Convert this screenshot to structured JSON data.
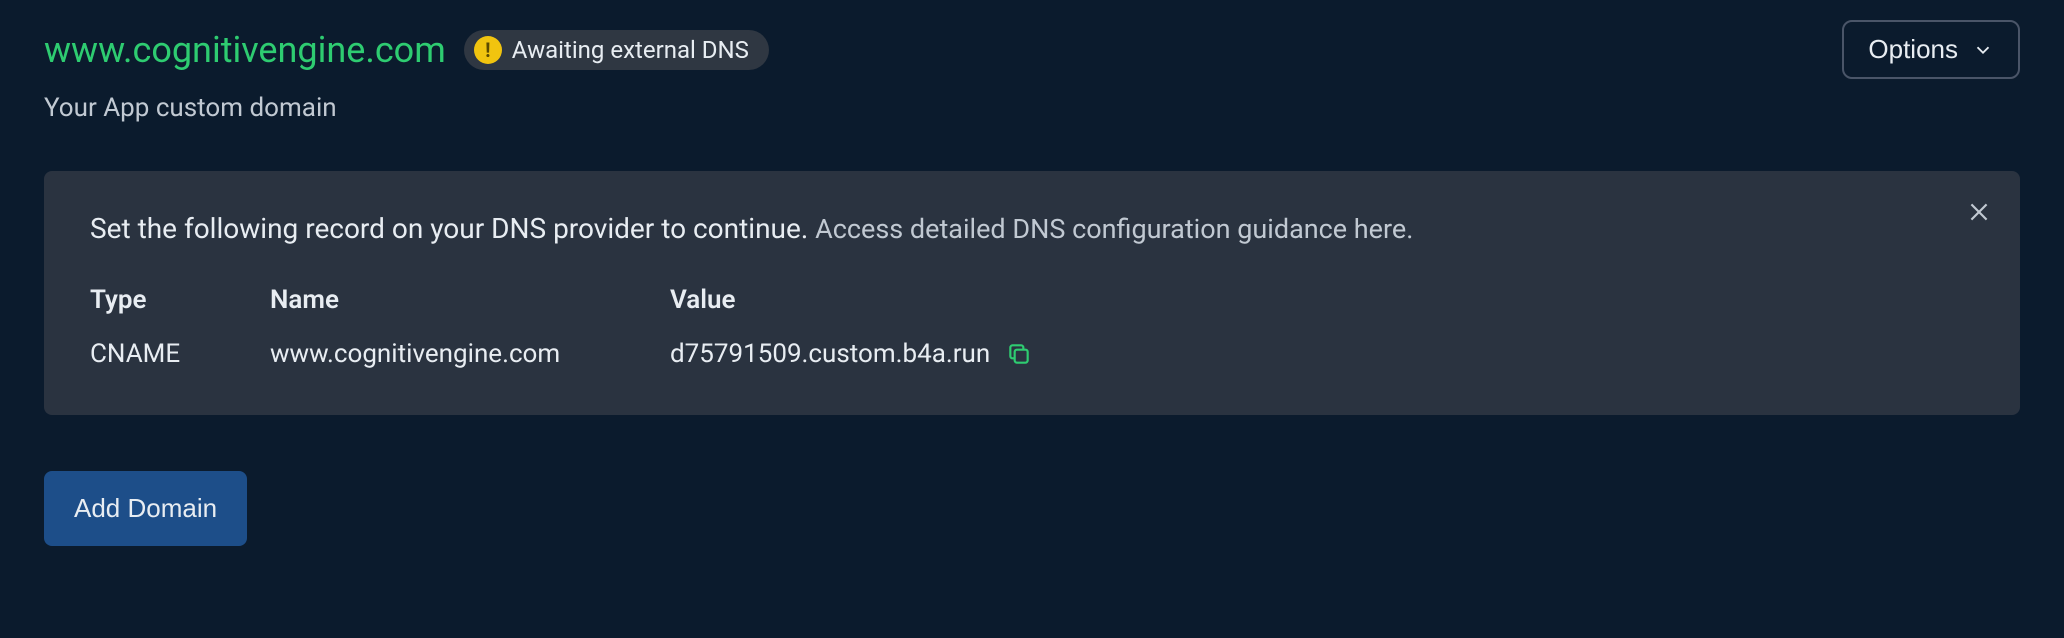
{
  "header": {
    "domain": "www.cognitivengine.com",
    "status": "Awaiting external DNS",
    "options_label": "Options"
  },
  "subtitle": "Your App custom domain",
  "panel": {
    "instruction": "Set the following record on your DNS provider to continue.",
    "link": "Access detailed DNS configuration guidance here.",
    "columns": {
      "type": "Type",
      "name": "Name",
      "value": "Value"
    },
    "record": {
      "type": "CNAME",
      "name": "www.cognitivengine.com",
      "value": "d75791509.custom.b4a.run"
    }
  },
  "actions": {
    "add_domain": "Add Domain"
  }
}
